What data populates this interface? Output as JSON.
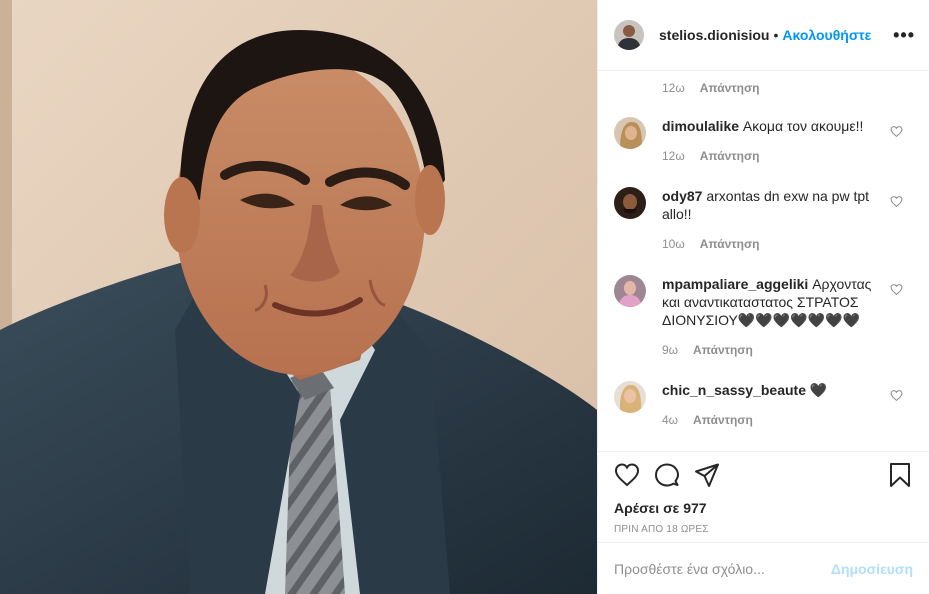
{
  "photo": {
    "alt_icon": "portrait-photo"
  },
  "header": {
    "username": "stelios.dionisiou",
    "dot": "•",
    "follow_label": "Ακολουθήστε",
    "more_label": "•••"
  },
  "comments": {
    "first_meta": {
      "time": "12ω",
      "reply": "Απάντηση"
    },
    "items": [
      {
        "username": "dimoulalike",
        "text": "Ακομα τον ακουμε!!",
        "time": "12ω",
        "reply": "Απάντηση"
      },
      {
        "username": "ody87",
        "text": "arxontas dn exw na pw tpt allo!!",
        "time": "10ω",
        "reply": "Απάντηση"
      },
      {
        "username": "mpampaliare_aggeliki",
        "text": "Αρχοντας και αναντικαταστατος ΣΤΡΑΤΟΣ ΔΙΟΝΥΣΙΟΥ🖤🖤🖤🖤🖤🖤🖤",
        "time": "9ω",
        "reply": "Απάντηση"
      },
      {
        "username": "chic_n_sassy_beaute",
        "text": "🖤",
        "time": "4ω",
        "reply": "Απάντηση"
      }
    ]
  },
  "actions": {
    "likes": "Αρέσει σε 977",
    "time": "ΠΡΙΝ ΑΠΟ 18 ΩΡΕΣ"
  },
  "add_comment": {
    "placeholder": "Προσθέστε ένα σχόλιο...",
    "post_label": "Δημοσίευση"
  },
  "colors": {
    "accent": "#0095f6",
    "post_disabled": "#b2dffc",
    "muted": "#8e8e8e",
    "text": "#262626"
  }
}
